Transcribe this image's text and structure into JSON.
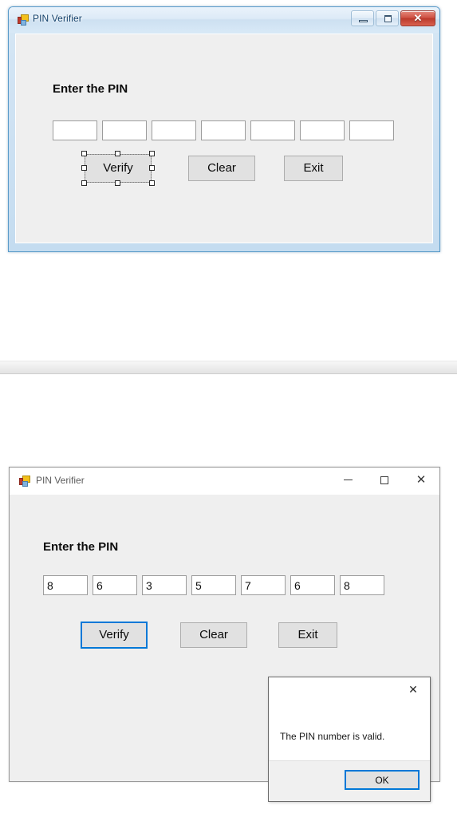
{
  "designer_window": {
    "title": "PIN Verifier",
    "icon": "vs-winform-icon",
    "controls": {
      "minimize": "minimize-icon",
      "maximize": "maximize-icon",
      "close": "✕"
    },
    "label": "Enter the PIN",
    "pin_boxes": [
      "",
      "",
      "",
      "",
      "",
      "",
      ""
    ],
    "buttons": {
      "verify": "Verify",
      "clear": "Clear",
      "exit": "Exit"
    },
    "selected_control": "Verify"
  },
  "running_window": {
    "title": "PIN Verifier",
    "icon": "vs-winform-icon",
    "controls": {
      "minimize": "—",
      "maximize": "maximize-icon",
      "close": "✕"
    },
    "label": "Enter the PIN",
    "pin_boxes": [
      "8",
      "6",
      "3",
      "5",
      "7",
      "6",
      "8"
    ],
    "buttons": {
      "verify": "Verify",
      "clear": "Clear",
      "exit": "Exit"
    },
    "focused_button": "Verify"
  },
  "message_box": {
    "close": "✕",
    "text": "The PIN number is valid.",
    "ok_label": "OK"
  },
  "background": {
    "faint_clipped_text": "···  ····  ······  ··  ····  ····"
  },
  "colors": {
    "accent_focus": "#0078d7",
    "form_face": "#efefef",
    "button_face": "#e1e1e1",
    "aero_glass": "#d6e7f5",
    "close_red": "#cf5244"
  }
}
